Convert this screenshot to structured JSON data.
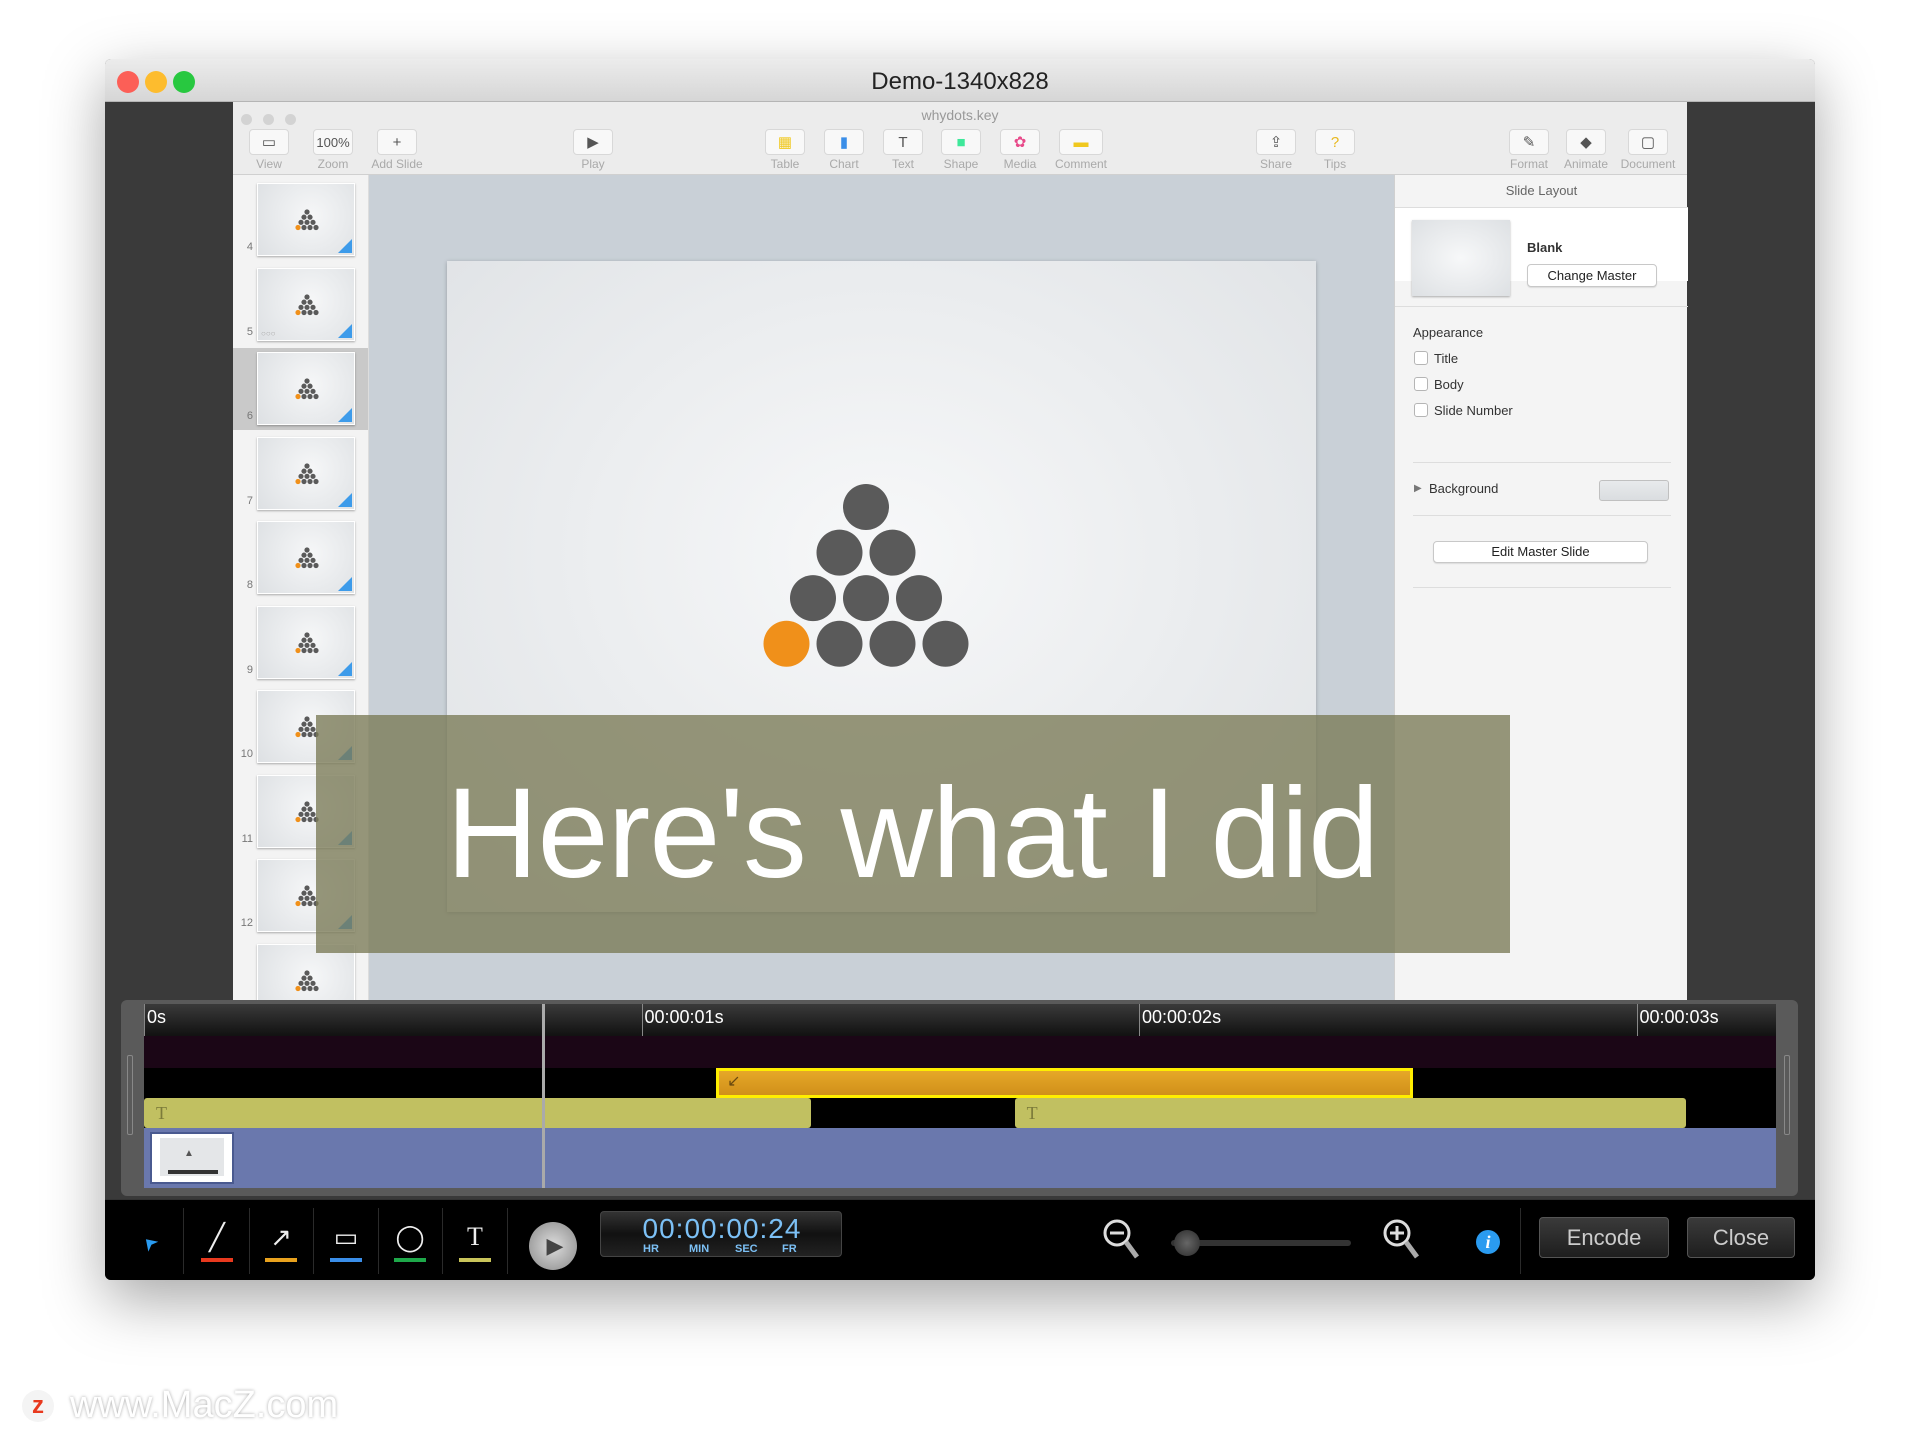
{
  "window": {
    "title": "Demo-1340x828"
  },
  "keynote": {
    "file_name": "whydots.key",
    "toolbar": [
      {
        "label": "View",
        "icon": "sidebar-view-icon"
      },
      {
        "label": "Zoom",
        "value": "100%"
      },
      {
        "label": "Add Slide",
        "icon": "plus-icon"
      },
      {
        "label": "Play",
        "icon": "play-icon"
      },
      {
        "label": "Table",
        "icon": "table-icon"
      },
      {
        "label": "Chart",
        "icon": "chart-icon"
      },
      {
        "label": "Text",
        "icon": "text-icon"
      },
      {
        "label": "Shape",
        "icon": "shape-icon"
      },
      {
        "label": "Media",
        "icon": "media-icon"
      },
      {
        "label": "Comment",
        "icon": "comment-icon"
      },
      {
        "label": "Share",
        "icon": "share-icon"
      },
      {
        "label": "Tips",
        "icon": "tips-icon"
      },
      {
        "label": "Format",
        "icon": "format-brush-icon"
      },
      {
        "label": "Animate",
        "icon": "animate-icon"
      },
      {
        "label": "Document",
        "icon": "document-icon"
      }
    ],
    "slides": [
      "4",
      "5",
      "6",
      "7",
      "8",
      "9",
      "10",
      "11",
      "12",
      ""
    ],
    "selected_slide": "6",
    "inspector": {
      "header": "Slide Layout",
      "master_name": "Blank",
      "change_master": "Change Master",
      "appearance": "Appearance",
      "checkboxes": [
        {
          "label": "Title",
          "checked": false
        },
        {
          "label": "Body",
          "checked": false
        },
        {
          "label": "Slide Number",
          "checked": false
        }
      ],
      "background": "Background",
      "edit_master": "Edit Master Slide"
    },
    "colors": {
      "orange_dot": "#f0901a",
      "gray_dot": "#5a5a5a"
    }
  },
  "caption": "Here's what I did",
  "timeline": {
    "ticks": [
      "0s",
      "00:00:01s",
      "00:00:02s",
      "00:00:03s"
    ],
    "playhead_seconds": 0.8,
    "clips": {
      "arrow": {
        "start": 1.15,
        "end": 2.55
      },
      "text1": {
        "start": 0,
        "end": 1.34
      },
      "text2": {
        "start": 1.75,
        "end": 3.1
      },
      "text_icon": "T"
    }
  },
  "toolbar": {
    "tools": [
      {
        "name": "select",
        "color": "#2a9bf0"
      },
      {
        "name": "line",
        "color": "#e8391e"
      },
      {
        "name": "arrow",
        "color": "#e8a21e"
      },
      {
        "name": "rectangle",
        "color": "#3a8ee8"
      },
      {
        "name": "ellipse",
        "color": "#1ea84a"
      },
      {
        "name": "text",
        "color": "#c9c45a",
        "glyph": "T"
      }
    ],
    "timecode": {
      "value": "00:00:00:24",
      "labels": [
        "HR",
        "MIN",
        "SEC",
        "FR"
      ]
    },
    "zoom_level": 0.03,
    "encode": "Encode",
    "close": "Close"
  },
  "watermark": "www.MacZ.com"
}
